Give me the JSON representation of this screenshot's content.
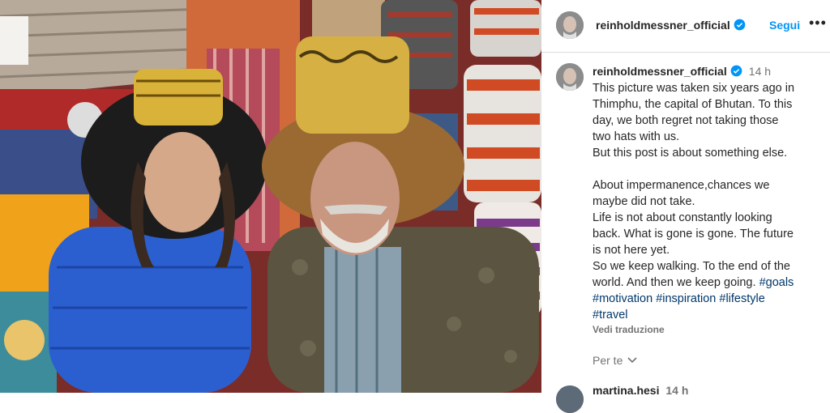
{
  "header": {
    "username": "reinholdmessner_official",
    "follow_label": "Segui",
    "more_label": "•••"
  },
  "caption": {
    "username": "reinholdmessner_official",
    "time": "14 h",
    "lines_a": [
      "This picture was taken six years ago in",
      "Thimphu, the capital of Bhutan. To this",
      "day, we both regret not taking those",
      "two hats with us.",
      "But this post is about something else."
    ],
    "lines_b": [
      "About impermanence,chances we",
      "maybe did not take.",
      "Life is not about constantly looking",
      "back. What is gone is gone. The future",
      "is not here yet.",
      "So we keep walking. To the end of the"
    ],
    "last_text": "world. And then we keep going. ",
    "hashtags": [
      "#goals",
      "#motivation",
      "#inspiration",
      "#lifestyle",
      "#travel"
    ],
    "translate_label": "Vedi traduzione"
  },
  "footer": {
    "for_you_label": "Per te",
    "next_comment_name": "martina.hesi",
    "next_comment_time": "14 h"
  },
  "colors": {
    "link": "#0095f6",
    "hashtag": "#00376b",
    "verified": "#0095f6",
    "muted": "#737373"
  }
}
